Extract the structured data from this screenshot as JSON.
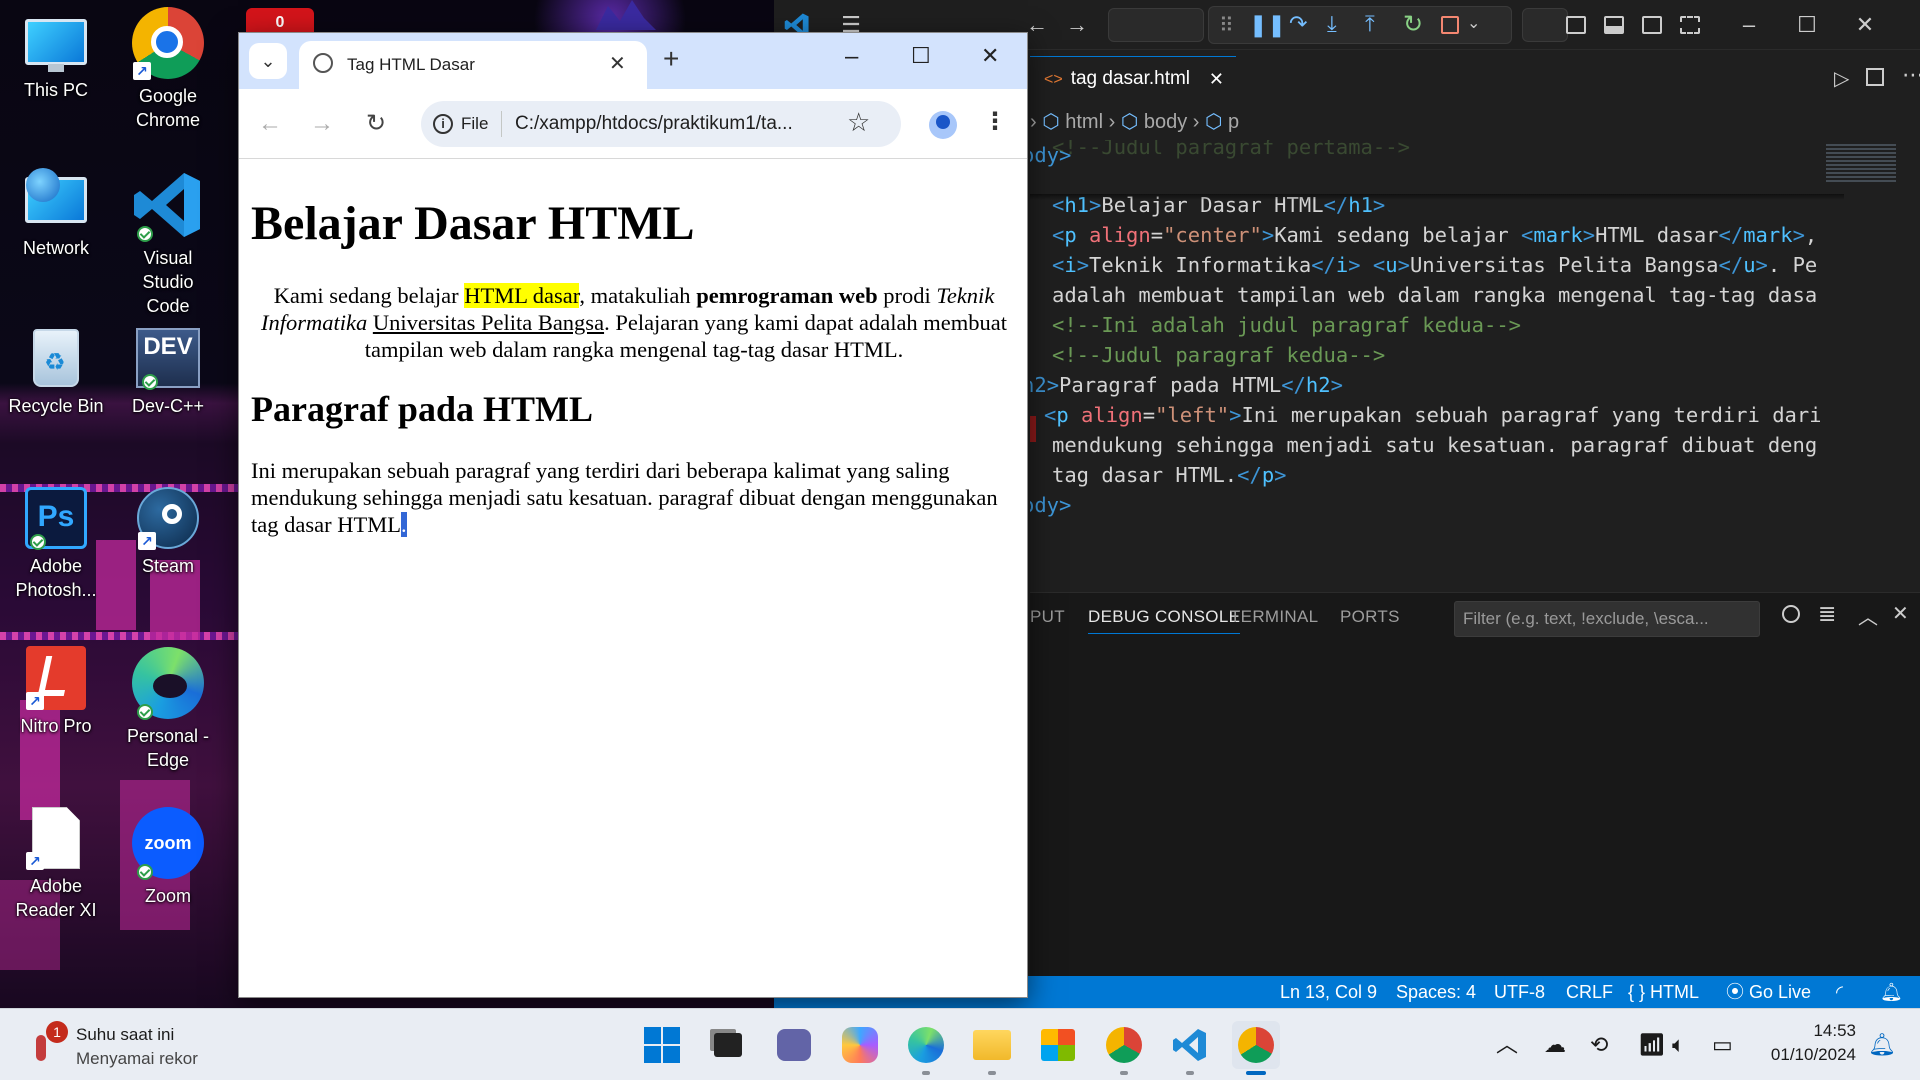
{
  "desktop": {
    "icons": [
      {
        "label": "This PC"
      },
      {
        "label": "Google\nChrome"
      },
      {
        "label": "Network"
      },
      {
        "label": "Visual Studio\nCode"
      },
      {
        "label": "Recycle Bin"
      },
      {
        "label": "Dev-C++"
      },
      {
        "label": "Adobe\nPhotosh..."
      },
      {
        "label": "Steam"
      },
      {
        "label": "Nitro Pro"
      },
      {
        "label": "Personal -\nEdge"
      },
      {
        "label": "Adobe\nReader XI"
      },
      {
        "label": "Zoom"
      }
    ],
    "notification_badge": "0"
  },
  "chrome": {
    "tab_title": "Tag HTML Dasar",
    "site_chip": "File",
    "address": "C:/xampp/htdocs/praktikum1/ta...",
    "page": {
      "h1": "Belajar Dasar HTML",
      "p1": {
        "t1": "Kami sedang belajar ",
        "mark": "HTML dasar",
        "t2": ", matakuliah ",
        "bold": "pemrograman web",
        "t3": " prodi ",
        "italic": "Teknik Informatika",
        "t4": " ",
        "underline": "Universitas Pelita Bangsa",
        "t5": ". Pelajaran yang kami dapat adalah membuat tampilan web dalam rangka mengenal tag-tag dasar HTML."
      },
      "h2": "Paragraf pada HTML",
      "p2": "Ini merupakan sebuah paragraf yang terdiri dari beberapa kalimat yang saling mendukung sehingga menjadi satu kesatuan. paragraf dibuat dengan menggunakan tag dasar HTML",
      "p2_selected": "."
    }
  },
  "vscode": {
    "tab": "tag dasar.html",
    "breadcrumb": [
      "html",
      "body",
      "p"
    ],
    "code_lines": [
      {
        "parts": [
          [
            "t-tag",
            "ody>"
          ]
        ]
      },
      {
        "parts": [
          [
            "t-com",
            "<!--Judul paragraf pertama-->"
          ]
        ]
      },
      {
        "parts": [
          [
            "t-tag",
            "<"
          ],
          [
            "t-name",
            "h1"
          ],
          [
            "t-tag",
            ">"
          ],
          [
            "t-txt",
            "Belajar Dasar HTML"
          ],
          [
            "t-tag",
            "</"
          ],
          [
            "t-name",
            "h1"
          ],
          [
            "t-tag",
            ">"
          ]
        ]
      },
      {
        "parts": [
          [
            "t-tag",
            "<"
          ],
          [
            "t-name",
            "p"
          ],
          [
            "t-txt",
            " "
          ],
          [
            "t-attr",
            "align"
          ],
          [
            "t-txt",
            "="
          ],
          [
            "t-str",
            "\"center\""
          ],
          [
            "t-tag",
            ">"
          ],
          [
            "t-txt",
            "Kami sedang belajar "
          ],
          [
            "t-tag",
            "<"
          ],
          [
            "t-name",
            "mark"
          ],
          [
            "t-tag",
            ">"
          ],
          [
            "t-txt",
            "HTML dasar"
          ],
          [
            "t-tag",
            "</"
          ],
          [
            "t-name",
            "mark"
          ],
          [
            "t-tag",
            ">"
          ],
          [
            "t-txt",
            ", "
          ]
        ]
      },
      {
        "parts": [
          [
            "t-tag",
            "<"
          ],
          [
            "t-name",
            "i"
          ],
          [
            "t-tag",
            ">"
          ],
          [
            "t-txt",
            "Teknik Informatika"
          ],
          [
            "t-tag",
            "</"
          ],
          [
            "t-name",
            "i"
          ],
          [
            "t-tag",
            ">"
          ],
          [
            "t-txt",
            " "
          ],
          [
            "t-tag",
            "<"
          ],
          [
            "t-name",
            "u"
          ],
          [
            "t-tag",
            ">"
          ],
          [
            "t-txt",
            "Universitas Pelita Bangsa"
          ],
          [
            "t-tag",
            "</"
          ],
          [
            "t-name",
            "u"
          ],
          [
            "t-tag",
            ">"
          ],
          [
            "t-txt",
            ". Pe"
          ]
        ]
      },
      {
        "parts": [
          [
            "t-txt",
            "adalah membuat tampilan web dalam rangka mengenal tag-tag dasa"
          ]
        ]
      },
      {
        "parts": [
          [
            "t-com",
            "<!--Ini adalah judul paragraf kedua-->"
          ]
        ]
      },
      {
        "parts": [
          [
            "t-com",
            "<!--Judul paragraf kedua-->"
          ]
        ]
      },
      {
        "parts": [
          [
            "t-tag",
            "h2"
          ],
          [
            "t-tag",
            ">"
          ],
          [
            "t-txt",
            "Paragraf pada HTML"
          ],
          [
            "t-tag",
            "</"
          ],
          [
            "t-name",
            "h2"
          ],
          [
            "t-tag",
            ">"
          ]
        ]
      },
      {
        "parts": [
          [
            "t-tag",
            "<"
          ],
          [
            "t-name",
            "p"
          ],
          [
            "t-txt",
            " "
          ],
          [
            "t-attr",
            "align"
          ],
          [
            "t-txt",
            "="
          ],
          [
            "t-str",
            "\"left\""
          ],
          [
            "t-tag",
            ">"
          ],
          [
            "t-txt",
            "Ini merupakan sebuah paragraf yang terdiri dari"
          ]
        ]
      },
      {
        "parts": [
          [
            "t-txt",
            "mendukung sehingga menjadi satu kesatuan. paragraf dibuat deng"
          ]
        ]
      },
      {
        "parts": [
          [
            "t-txt",
            "tag dasar HTML."
          ],
          [
            "t-tag",
            "</"
          ],
          [
            "t-name",
            "p"
          ],
          [
            "t-tag",
            ">"
          ]
        ]
      },
      {
        "parts": [
          [
            "t-tag",
            "ody>"
          ]
        ]
      }
    ],
    "panel_tabs": [
      "PUT",
      "DEBUG CONSOLE",
      "TERMINAL",
      "PORTS"
    ],
    "filter_placeholder": "Filter (e.g. text, !exclude, \\esca...",
    "status": {
      "position": "Ln 13, Col 9",
      "spaces": "Spaces: 4",
      "encoding": "UTF-8",
      "eol": "CRLF",
      "language": "HTML",
      "golive": "Go Live"
    }
  },
  "taskbar": {
    "weather_title": "Suhu saat ini",
    "weather_sub": "Menyamai rekor",
    "weather_badge": "1",
    "time": "14:53",
    "date": "01/10/2024"
  }
}
